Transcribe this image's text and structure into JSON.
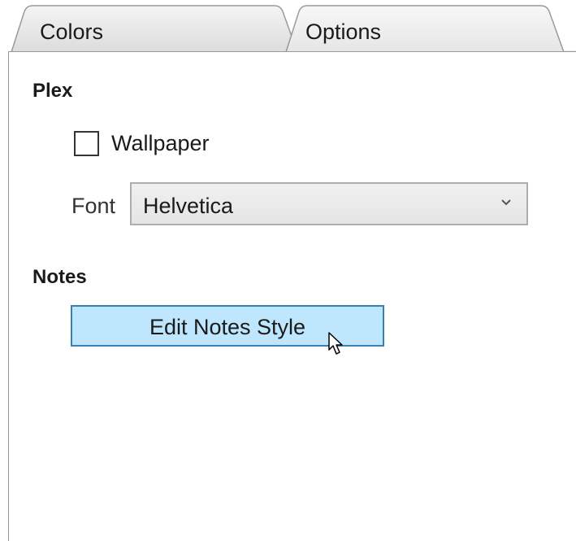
{
  "tabs": {
    "colors_label": "Colors",
    "options_label": "Options",
    "selected": "Options"
  },
  "plex": {
    "title": "Plex",
    "wallpaper": {
      "label": "Wallpaper",
      "checked": false
    },
    "font": {
      "label": "Font",
      "value": "Helvetica",
      "icon": "chevron-down-icon"
    }
  },
  "notes": {
    "title": "Notes",
    "edit_button_label": "Edit Notes Style"
  },
  "colors": {
    "button_hover_bg": "#bee6fd",
    "button_hover_border": "#3c7fb1",
    "panel_border": "#9a9a9a"
  }
}
